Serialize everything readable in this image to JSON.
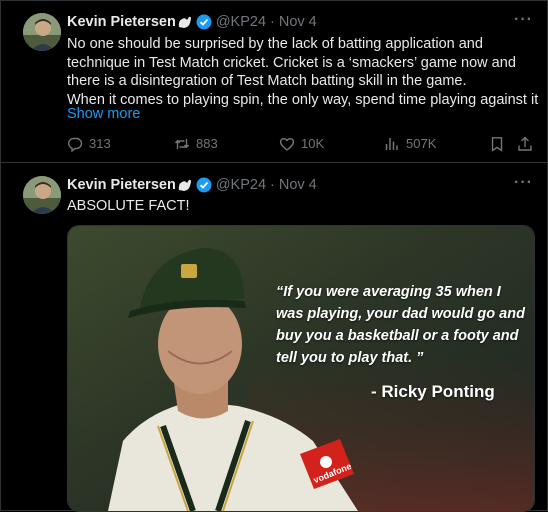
{
  "tweets": [
    {
      "author": "Kevin Pietersen",
      "handle": "@KP24",
      "date": "· Nov 4",
      "text_lines": [
        "No one should be surprised by the lack of batting application and",
        "technique in Test Match cricket. Cricket is a ‘smackers’ game now and",
        "there is a disintegration of Test Match batting skill in the game.",
        "When it comes to playing spin, the only way, spend time playing against it"
      ],
      "show_more": "Show more",
      "actions": {
        "replies": "313",
        "reposts": "883",
        "likes": "10K",
        "views": "507K"
      }
    },
    {
      "author": "Kevin Pietersen",
      "handle": "@KP24",
      "date": "· Nov 4",
      "text": "ABSOLUTE FACT!",
      "media": {
        "quote_lines": [
          "“If you were averaging 35 when I",
          "was playing, your dad would go and",
          "buy you a basketball or a footy and",
          "tell you to play that. ”"
        ],
        "attribution": "- Ricky Ponting",
        "sponsor_text": "vodafone"
      }
    }
  ],
  "icons": {
    "more": "more-horizontal-icon",
    "reply": "reply-icon",
    "repost": "repost-icon",
    "like": "heart-icon",
    "views": "views-chart-icon",
    "bookmark": "bookmark-icon",
    "share": "share-icon",
    "verified": "verified-badge-icon"
  },
  "colors": {
    "background": "#000000",
    "text": "#e7e9ea",
    "muted": "#71767b",
    "link": "#1d9bf0",
    "verified": "#1d9bf0",
    "border": "#2f3336"
  }
}
